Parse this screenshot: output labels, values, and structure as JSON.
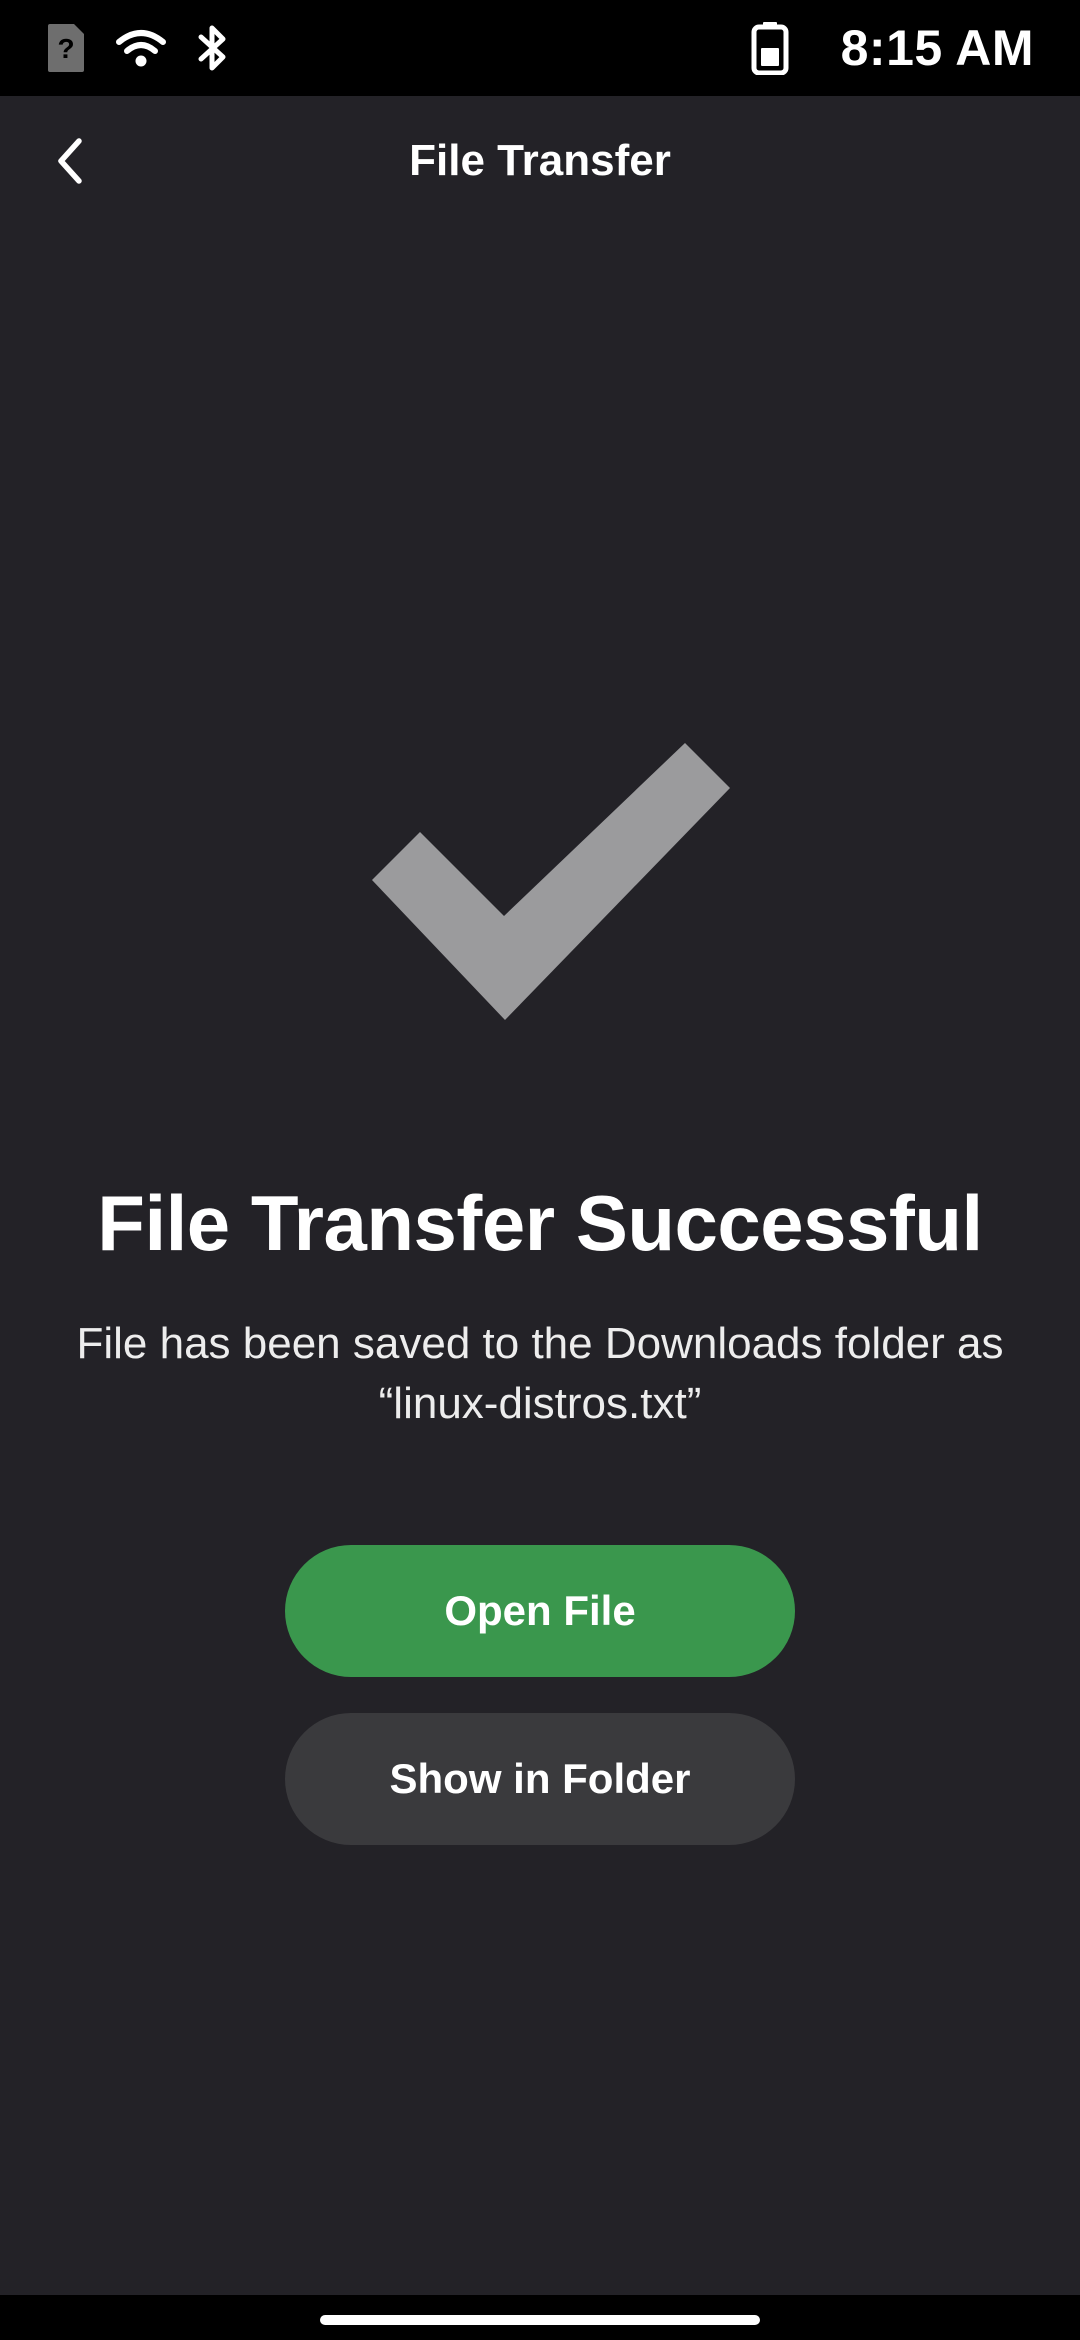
{
  "status_bar": {
    "time": "8:15 AM",
    "icons": [
      "sim-unknown-icon",
      "wifi-icon",
      "bluetooth-icon",
      "battery-icon"
    ]
  },
  "header": {
    "title": "File Transfer",
    "back_icon": "chevron-left-icon"
  },
  "result": {
    "icon": "checkmark-icon",
    "title": "File Transfer Successful",
    "message": "File has been saved to the Downloads folder as “linux-distros.txt”"
  },
  "actions": {
    "primary_label": "Open File",
    "secondary_label": "Show in Folder"
  },
  "colors": {
    "background": "#232227",
    "primary_button": "#3a974d",
    "secondary_button": "#3a3a3d",
    "checkmark": "#9b9b9d"
  }
}
